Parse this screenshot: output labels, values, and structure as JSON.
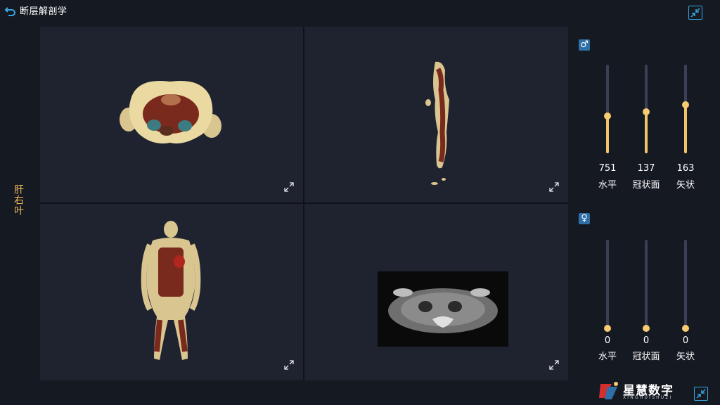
{
  "header": {
    "title": "断层解剖学"
  },
  "organ_label": "肝右叶",
  "sliders_male": {
    "icon": "male-symbol-icon",
    "sliders": [
      {
        "value": "751",
        "label": "水平",
        "level": 0.42
      },
      {
        "value": "137",
        "label": "冠状面",
        "level": 0.47
      },
      {
        "value": "163",
        "label": "矢状",
        "level": 0.55
      }
    ]
  },
  "sliders_female": {
    "icon": "female-symbol-icon",
    "sliders": [
      {
        "value": "0",
        "label": "水平",
        "level": 0
      },
      {
        "value": "0",
        "label": "冠状面",
        "level": 0
      },
      {
        "value": "0",
        "label": "矢状",
        "level": 0
      }
    ]
  },
  "logo": {
    "name": "星慧数字",
    "sub": "XINGHUISHUZI"
  },
  "colors": {
    "accent": "#f2c46a",
    "label": "#f2b95a",
    "border_icon": "#3aa6e0",
    "pane_bg": "#1f2330"
  }
}
